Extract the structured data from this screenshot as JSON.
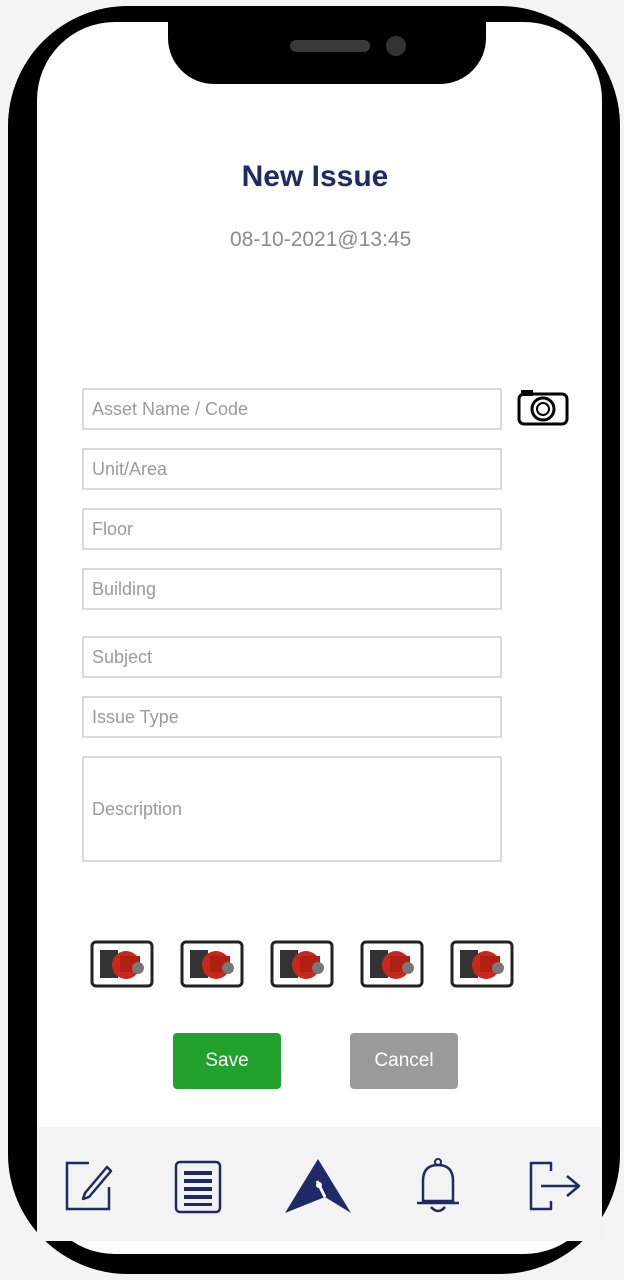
{
  "header": {
    "title": "New Issue",
    "datetime": "08-10-2021@13:45"
  },
  "form": {
    "asset_placeholder": "Asset Name / Code",
    "unit_placeholder": "Unit/Area",
    "floor_placeholder": "Floor",
    "building_placeholder": "Building",
    "subject_placeholder": "Subject",
    "issue_type_placeholder": "Issue Type",
    "description_placeholder": "Description"
  },
  "attachments": [
    "engine-pump-thumbnail",
    "engine-pump-thumbnail",
    "engine-pump-thumbnail",
    "engine-pump-thumbnail",
    "engine-pump-thumbnail"
  ],
  "actions": {
    "save_label": "Save",
    "cancel_label": "Cancel"
  },
  "nav": {
    "items": [
      "edit-icon",
      "list-icon",
      "home-logo-icon",
      "bell-icon",
      "logout-icon"
    ]
  },
  "colors": {
    "title": "#1f2a66",
    "save": "#23a12e",
    "cancel": "#9a9a9a",
    "nav_icon": "#1f2a66"
  }
}
